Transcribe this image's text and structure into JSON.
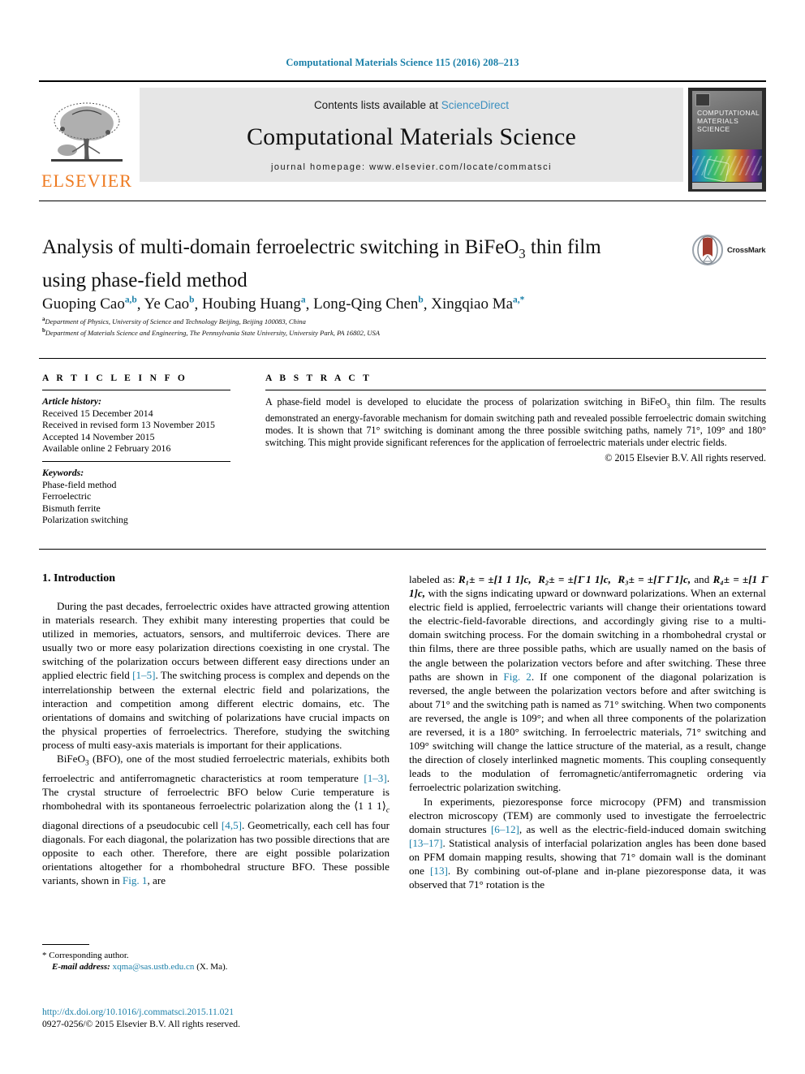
{
  "running_head": "Computational Materials Science 115 (2016) 208–213",
  "masthead": {
    "publisher_logo_text": "ELSEVIER",
    "contents_prefix": "Contents lists available at ",
    "contents_link": "ScienceDirect",
    "journal_name": "Computational Materials Science",
    "homepage": "journal homepage: www.elsevier.com/locate/commatsci",
    "cover_title_line1": "COMPUTATIONAL",
    "cover_title_line2": "MATERIALS",
    "cover_title_line3": "SCIENCE"
  },
  "article": {
    "title_line1": "Analysis of multi-domain ferroelectric switching in BiFeO",
    "title_sub": "3",
    "title_line1_tail": " thin film",
    "title_line2": "using phase-field method",
    "crossmark_label": "CrossMark",
    "authors": [
      {
        "name": "Guoping Cao",
        "sup": "a,b"
      },
      {
        "name": "Ye Cao",
        "sup": "b"
      },
      {
        "name": "Houbing Huang",
        "sup": "a"
      },
      {
        "name": "Long-Qing Chen",
        "sup": "b"
      },
      {
        "name": "Xingqiao Ma",
        "sup": "a,*"
      }
    ],
    "affiliations": [
      {
        "mark": "a",
        "text": "Department of Physics, University of Science and Technology Beijing, Beijing 100083, China"
      },
      {
        "mark": "b",
        "text": "Department of Materials Science and Engineering, The Pennsylvania State University, University Park, PA 16802, USA"
      }
    ]
  },
  "article_info": {
    "heading": "A R T I C L E   I N F O",
    "history_label": "Article history:",
    "history": [
      "Received 15 December 2014",
      "Received in revised form 13 November 2015",
      "Accepted 14 November 2015",
      "Available online 2 February 2016"
    ],
    "keywords_label": "Keywords:",
    "keywords": [
      "Phase-field method",
      "Ferroelectric",
      "Bismuth ferrite",
      "Polarization switching"
    ]
  },
  "abstract": {
    "heading": "A B S T R A C T",
    "text_part1": "A phase-field model is developed to elucidate the process of polarization switching in BiFeO",
    "text_sub": "3",
    "text_part2": " thin film. The results demonstrated an energy-favorable mechanism for domain switching path and revealed possible ferroelectric domain switching modes. It is shown that 71° switching is dominant among the three possible switching paths, namely 71°, 109° and 180° switching. This might provide significant references for the application of ferroelectric materials under electric fields.",
    "copyright": "© 2015 Elsevier B.V. All rights reserved."
  },
  "body": {
    "section_heading": "1. Introduction",
    "left_p1_a": "During the past decades, ferroelectric oxides have attracted growing attention in materials research. They exhibit many interesting properties that could be utilized in memories, actuators, sensors, and multiferroic devices. There are usually two or more easy polarization directions coexisting in one crystal. The switching of the polarization occurs between different easy directions under an applied electric field ",
    "left_p1_ref1": "[1–5]",
    "left_p1_b": ". The switching process is complex and depends on the interrelationship between the external electric field and polarizations, the interaction and competition among different electric domains, etc. The orientations of domains and switching of polarizations have crucial impacts on the physical properties of ferroelectrics. Therefore, studying the switching process of multi easy-axis materials is important for their applications.",
    "left_p2_a": "BiFeO",
    "left_p2_sub": "3",
    "left_p2_b": " (BFO), one of the most studied ferroelectric materials, exhibits both ferroelectric and antiferromagnetic characteristics at room temperature ",
    "left_p2_ref1": "[1–3]",
    "left_p2_c": ". The crystal structure of ferroelectric BFO below Curie temperature is rhombohedral with its spontaneous ferroelectric polarization along the ⟨1 1 1⟩",
    "left_p2_csub": "c",
    "left_p2_d": " diagonal directions of a pseudocubic cell ",
    "left_p2_ref2": "[4,5]",
    "left_p2_e": ". Geometrically, each cell has four diagonals. For each diagonal, the polarization has two possible directions that are opposite to each other. Therefore, there are eight possible polarization orientations altogether for a rhombohedral structure BFO. These possible variants, shown in ",
    "left_p2_figref": "Fig. 1",
    "left_p2_f": ", are",
    "right_p1_lead": "labeled   as:  ",
    "right_eq1": "R₁± = ±[1 1 1]c,",
    "right_eq2": "R₂± = ±[1̄ 1 1]c,",
    "right_eq3": "R₃± = ±[1̄ 1̄ 1]c,",
    "right_eq_and": "and",
    "right_eq4": "R₄± = ±[1 1̄ 1]c,",
    "right_p1_a": " with the signs indicating upward or downward polarizations. When an external electric field is applied, ferroelectric variants will change their orientations toward the electric-field-favorable directions, and accordingly giving rise to a multi-domain switching process. For the domain switching in a rhombohedral crystal or thin films, there are three possible paths, which are usually named on the basis of the angle between the polarization vectors before and after switching. These three paths are shown in ",
    "right_p1_figref": "Fig. 2",
    "right_p1_b": ". If one component of the diagonal polarization is reversed, the angle between the polarization vectors before and after switching is about 71° and the switching path is named as 71° switching. When two components are reversed, the angle is 109°; and when all three components of the polarization are reversed, it is a 180° switching. In ferroelectric materials, 71° switching and 109° switching will change the lattice structure of the material, as a result, change the direction of closely interlinked magnetic moments. This coupling consequently leads to the modulation of ferromagnetic/antiferromagnetic ordering via ferroelectric polarization switching.",
    "right_p2_a": "In experiments, piezoresponse force microcopy (PFM) and transmission electron microscopy (TEM) are commonly used to investigate the ferroelectric domain structures ",
    "right_p2_ref1": "[6–12]",
    "right_p2_b": ", as well as the electric-field-induced domain switching ",
    "right_p2_ref2": "[13–17]",
    "right_p2_c": ". Statistical analysis of interfacial polarization angles has been done based on PFM domain mapping results, showing that 71° domain wall is the dominant one ",
    "right_p2_ref3": "[13]",
    "right_p2_d": ". By combining out-of-plane and in-plane piezoresponse data, it was observed that 71° rotation is the"
  },
  "footer": {
    "corresponding_marker": "*",
    "corresponding_text": "Corresponding author.",
    "email_label": "E-mail address:",
    "email": "xqma@sas.ustb.edu.cn",
    "email_suffix": "(X. Ma).",
    "doi_url": "http://dx.doi.org/10.1016/j.commatsci.2015.11.021",
    "issn_line": "0927-0256/© 2015 Elsevier B.V. All rights reserved."
  },
  "colors": {
    "link": "#1a7fa8",
    "elsevier_orange": "#ee7b22",
    "masthead_gray": "#e6e6e6"
  }
}
